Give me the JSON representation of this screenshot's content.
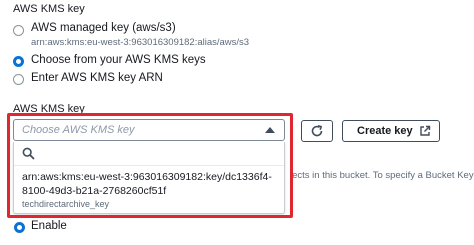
{
  "kms": {
    "section_label": "AWS KMS key",
    "options": [
      {
        "label": "AWS managed key (aws/s3)",
        "description": "arn:aws:kms:eu-west-3:963016309182:alias/aws/s3",
        "selected": false
      },
      {
        "label": "Choose from your AWS KMS keys",
        "selected": true
      },
      {
        "label": "Enter AWS KMS key ARN",
        "selected": false
      }
    ]
  },
  "key_select": {
    "label": "AWS KMS key",
    "placeholder": "Choose AWS KMS key",
    "refresh_icon": "refresh-icon",
    "create_key_label": "Create key",
    "external_link_icon": "external-link-icon",
    "search_icon": "search-icon",
    "option": {
      "arn_line1": "arn:aws:kms:eu-west-3:963016309182:key/dc1336f4-",
      "arn_line2": "8100-49d3-b21a-2768260cf51f",
      "alias": "techdirectarchive_key"
    },
    "highlight_color": "#e0262e"
  },
  "background_text": "jects in this bucket. To specify a Bucket Key sett",
  "bucket_key": {
    "enable_label": "Enable",
    "selected": true
  },
  "colors": {
    "accent": "#0972d3"
  }
}
